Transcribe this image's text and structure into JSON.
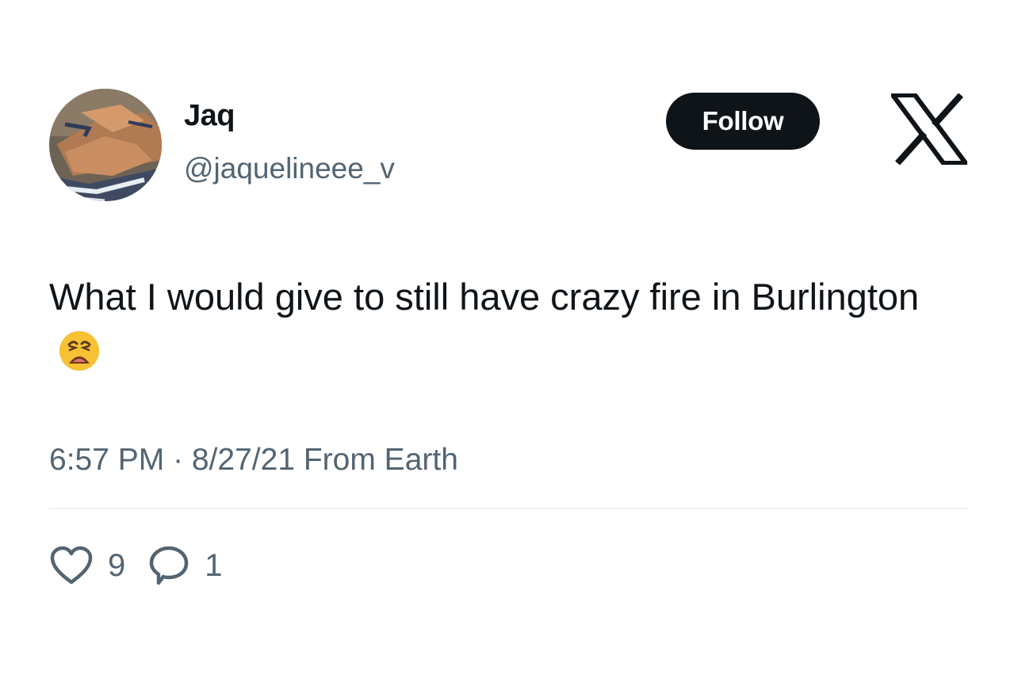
{
  "tweet": {
    "author": {
      "display_name": "Jaq",
      "handle": "@jaquelineee_v",
      "avatar_icon": "avatar-photo"
    },
    "follow_label": "Follow",
    "brand_icon": "x-logo-icon",
    "text": "What I would give to still have crazy fire in Burlington",
    "emoji": "weary-face-emoji",
    "timestamp": "6:57 PM · 8/27/21 From Earth",
    "likes": "9",
    "replies": "1"
  },
  "colors": {
    "text_primary": "#0f1419",
    "text_secondary": "#536471",
    "follow_bg": "#0f1419",
    "divider": "#eff3f4",
    "emoji": "#f7c133"
  }
}
